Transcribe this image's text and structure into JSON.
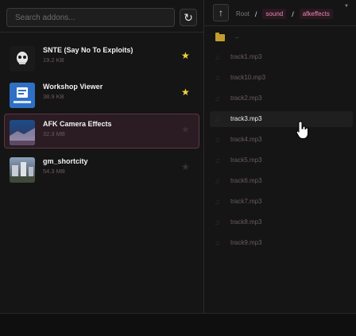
{
  "search": {
    "placeholder": "Search addons...",
    "value": ""
  },
  "refresh_icon": "↻",
  "addons": [
    {
      "title": "SNTE (Say No To Exploits)",
      "size": "19.2 KB",
      "favorite": true,
      "icon": "snte-thumbnail"
    },
    {
      "title": "Workshop Viewer",
      "size": "38.9 KB",
      "favorite": true,
      "icon": "workshop-viewer-thumbnail"
    },
    {
      "title": "AFK Camera Effects",
      "size": "32.3 MB",
      "favorite": false,
      "selected": true,
      "icon": "afk-camera-thumbnail"
    },
    {
      "title": "gm_shortcity",
      "size": "54.3 MB",
      "favorite": false,
      "icon": "gm-shortcity-thumbnail"
    }
  ],
  "star_glyph": "★",
  "browser": {
    "up_icon": "↑",
    "breadcrumb": {
      "root": "Root",
      "sep": "/",
      "items": [
        "sound",
        "afkeffects"
      ]
    },
    "caret": "▼",
    "folder_label": "..",
    "file_glyph": "♫",
    "files": [
      {
        "name": "track1.mp3"
      },
      {
        "name": "track10.mp3"
      },
      {
        "name": "track2.mp3"
      },
      {
        "name": "track3.mp3",
        "selected": true
      },
      {
        "name": "track4.mp3"
      },
      {
        "name": "track5.mp3"
      },
      {
        "name": "track6.mp3"
      },
      {
        "name": "track7.mp3"
      },
      {
        "name": "track8.mp3"
      },
      {
        "name": "track9.mp3"
      }
    ]
  },
  "colors": {
    "accent": "#e38bb4",
    "star": "#f2d33b",
    "folder": "#c39d2d",
    "selected_bg": "#2a1c22"
  }
}
